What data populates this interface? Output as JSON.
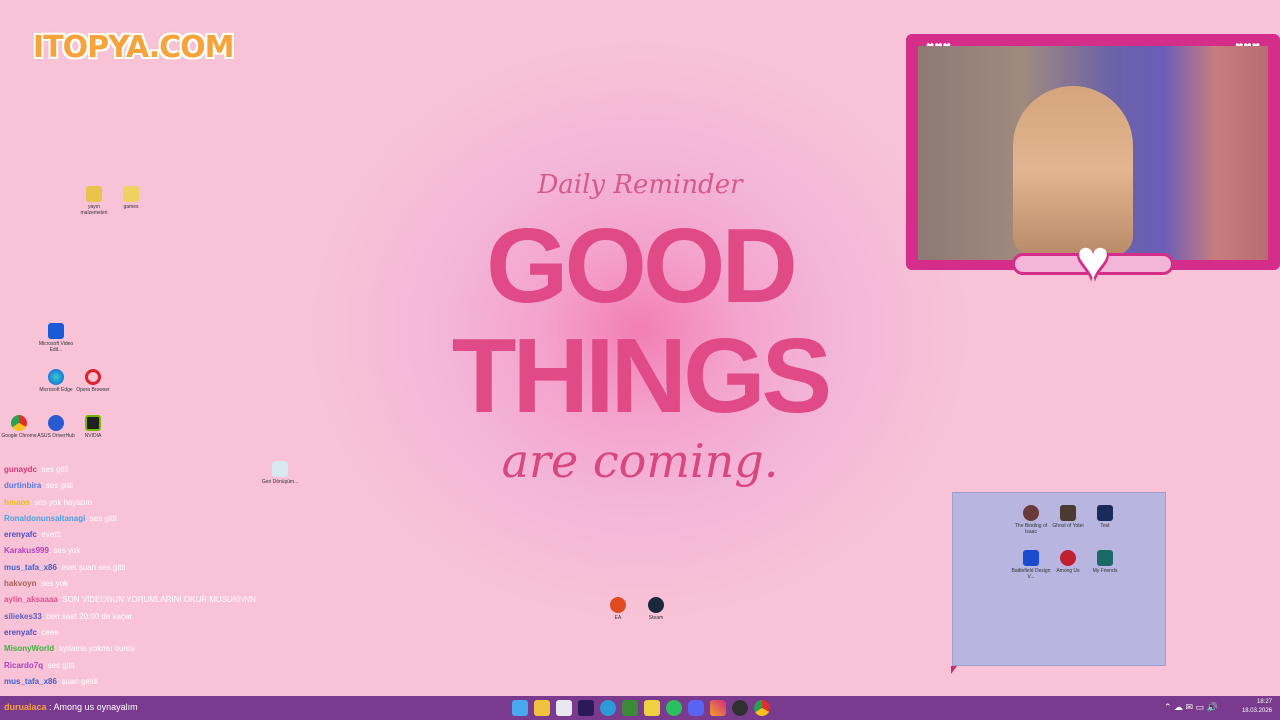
{
  "logo": "ITOPYA.COM",
  "wallpaper": {
    "subtitle": "Daily Reminder",
    "line1": "GOOD",
    "line2": "THINGS",
    "line3": "are coming."
  },
  "desktop_icons": [
    {
      "label": "yayın malzemeleri",
      "icon": "folder-icon"
    },
    {
      "label": "games",
      "icon": "folder-icon"
    },
    {
      "label": "Microsoft Video Edit...",
      "icon": "video-editor-icon"
    },
    {
      "label": "Microsoft Edge",
      "icon": "edge-icon"
    },
    {
      "label": "Opera Browser",
      "icon": "opera-icon"
    },
    {
      "label": "Google Chrome",
      "icon": "chrome-icon"
    },
    {
      "label": "ASUS DriverHub",
      "icon": "asus-icon"
    },
    {
      "label": "NVIDIA",
      "icon": "nvidia-icon"
    },
    {
      "label": "Geri Dönüşüm...",
      "icon": "recycle-bin-icon"
    },
    {
      "label": "EA",
      "icon": "ea-icon"
    },
    {
      "label": "Steam",
      "icon": "steam-icon"
    }
  ],
  "selection_icons": [
    {
      "label": "The Binding of Isaac",
      "icon": "isaac-icon"
    },
    {
      "label": "Ghost of Yotei",
      "icon": "game-icon"
    },
    {
      "label": "Test",
      "icon": "test-icon"
    },
    {
      "label": "Battlefield Design V...",
      "icon": "battlefield-icon"
    },
    {
      "label": "Among Us",
      "icon": "among-us-icon"
    },
    {
      "label": "My Friends",
      "icon": "game-icon"
    }
  ],
  "chat": [
    {
      "user": "gunaydc",
      "msg": ": ses gitti",
      "color": "#d43a7a"
    },
    {
      "user": "durtinbira",
      "msg": ": ses gitti",
      "color": "#5a7be0"
    },
    {
      "user": "hmaos",
      "msg": ": ses yok hayatım",
      "color": "#e8c020"
    },
    {
      "user": "Ronaldonunsaltanagi",
      "msg": ": ses gitti",
      "color": "#4aa0e0"
    },
    {
      "user": "erenyafc",
      "msg": ": evettt",
      "color": "#5050c0"
    },
    {
      "user": "Karakus999",
      "msg": ": ses yok",
      "color": "#b040c0"
    },
    {
      "user": "mus_tafa_x86",
      "msg": ": evet şuan ses gitti",
      "color": "#4060d0"
    },
    {
      "user": "hakvoyn",
      "msg": ": ses yok",
      "color": "#a06060"
    },
    {
      "user": "aylin_aksaaaa",
      "msg": ": SON VİDEONUN YORUMLARINI OKUR MUSUNNNN",
      "color": "#e05090"
    },
    {
      "user": "siliekes33",
      "msg": ": ben saat 20:00 de kaçar",
      "color": "#6060c0"
    },
    {
      "user": "erenyafc",
      "msg": ": ceee",
      "color": "#5050c0"
    },
    {
      "user": "MisonyWorld",
      "msg": ": ayılama yokmu burda",
      "color": "#40b040"
    },
    {
      "user": "Ricardo7q",
      "msg": ": ses gitti",
      "color": "#b040c0"
    },
    {
      "user": "mus_tafa_x86",
      "msg": ": şuan geldi",
      "color": "#4060d0"
    }
  ],
  "taskbar": {
    "last_user": "durualaca",
    "last_msg": ": Among us oynayalım",
    "time": "18:27",
    "date": "18.03.2026"
  },
  "colors": {
    "taskbar": "#7a3b8f",
    "cam_frame": "#d42e8a",
    "accent": "#e04a86"
  }
}
